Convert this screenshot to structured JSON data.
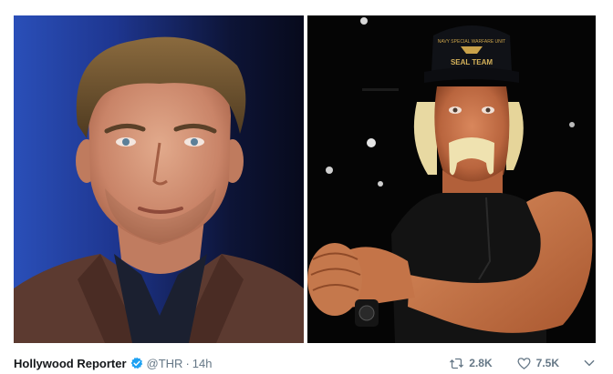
{
  "tweet": {
    "author_name": "Hollywood Reporter",
    "handle": "@THR",
    "separator": "·",
    "time": "14h",
    "retweets": "2.8K",
    "likes": "7.5K"
  },
  "photos": [
    {
      "subject": "photo-left"
    },
    {
      "subject": "photo-right",
      "cap_text": "SEAL TEAM",
      "cap_arc_text": "NAVY SPECIAL WARFARE UNIT"
    }
  ],
  "icons": {
    "verified": "verified-badge-icon",
    "retweet": "retweet-icon",
    "like": "heart-icon",
    "menu": "chevron-down-icon"
  },
  "colors": {
    "verified": "#1da1f2",
    "meta_text": "#657786",
    "name_text": "#14171a"
  }
}
